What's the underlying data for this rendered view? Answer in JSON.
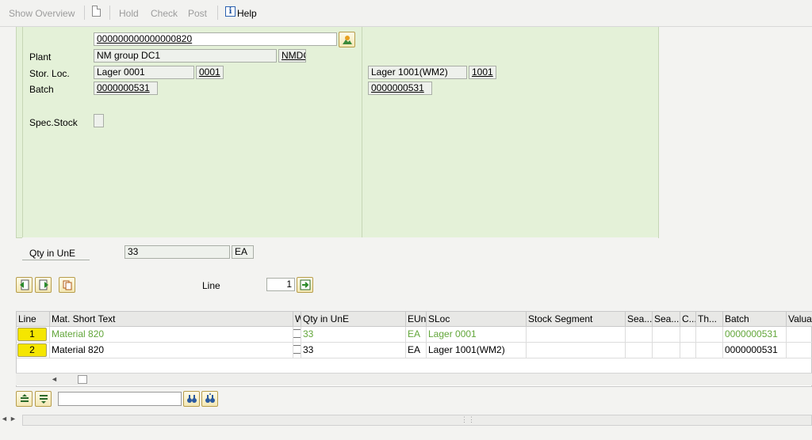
{
  "toolbar": {
    "show_overview": "Show Overview",
    "hold": "Hold",
    "check": "Check",
    "post": "Post",
    "help": "Help",
    "icons": [
      "document-icon",
      "info-icon"
    ]
  },
  "header": {
    "material_value": "000000000000000820",
    "plant_label": "Plant",
    "plant_name": "NM group DC1",
    "plant_code": "NMDC",
    "storloc_label": "Stor. Loc.",
    "storloc_name": "Lager 0001",
    "storloc_code": "0001",
    "batch_label": "Batch",
    "batch_value": "0000000531",
    "spec_stock_label": "Spec.Stock",
    "dest_storloc_name": "Lager 1001(WM2)",
    "dest_storloc_code": "1001",
    "dest_batch_value": "0000000531"
  },
  "qty": {
    "label": "Qty in UnE",
    "value": "33",
    "unit": "EA"
  },
  "line_nav": {
    "label": "Line",
    "value": "1"
  },
  "table": {
    "columns": [
      "Line",
      "Mat. Short Text",
      "W",
      "Qty in UnE",
      "EUn",
      "SLoc",
      "Stock Segment",
      "Sea...",
      "Sea...",
      "C...",
      "Th...",
      "Batch",
      "Valuat"
    ],
    "rows": [
      {
        "line": "1",
        "text": "Material 820",
        "qty": "33",
        "eun": "EA",
        "sloc": "Lager 0001",
        "batch": "0000000531",
        "highlight": true
      },
      {
        "line": "2",
        "text": "Material 820",
        "qty": "33",
        "eun": "EA",
        "sloc": "Lager 1001(WM2)",
        "batch": "0000000531",
        "highlight": false
      }
    ]
  },
  "colors": {
    "panel_bg": "#e4f1d8",
    "row_green": "#62a63a",
    "line_button": "#f5e600"
  }
}
